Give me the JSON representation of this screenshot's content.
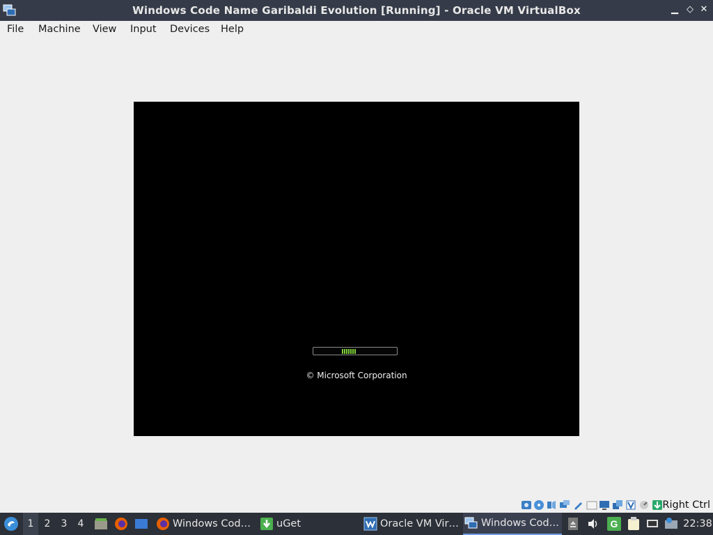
{
  "window": {
    "title": "Windows Code Name Garibaldi Evolution [Running] - Oracle VM VirtualBox",
    "minimize_glyph": "▁",
    "restore_glyph": "◇",
    "close_glyph": "✕"
  },
  "menu": {
    "items": [
      "File",
      "Machine",
      "View",
      "Input",
      "Devices",
      "Help"
    ]
  },
  "vm": {
    "copyright": "© Microsoft Corporation"
  },
  "statusbar": {
    "icons": [
      "hard-disk-icon",
      "optical-drive-icon",
      "audio-icon",
      "network-icon",
      "usb-icon",
      "shared-folders-icon",
      "display-icon",
      "recording-icon",
      "video-capture-icon",
      "cpu-icon",
      "mouse-integration-icon",
      "keyboard-icon"
    ],
    "host_key": "Right Ctrl"
  },
  "taskbar": {
    "workspaces": [
      "1",
      "2",
      "3",
      "4"
    ],
    "active_workspace": "1",
    "launchers": [
      "file-manager-icon",
      "firefox-icon",
      "desktop-icon"
    ],
    "tasks": [
      {
        "label": "Windows Cod…",
        "icon": "firefox-icon"
      },
      {
        "label": "uGet",
        "icon": "uget-icon"
      },
      {
        "label": "Oracle VM Vir…",
        "icon": "virtualbox-manager-icon"
      },
      {
        "label": "Windows Cod…",
        "icon": "virtualbox-vm-icon",
        "active": true
      }
    ],
    "tray_icons": [
      "eject-icon",
      "volume-icon",
      "uget-tray-icon",
      "clipboard-icon",
      "network-tray-icon",
      "updates-icon"
    ],
    "clock": "22:38"
  },
  "colors": {
    "titlebar": "#353b48",
    "taskbar": "#2c3038",
    "progress_green": "#7fcf3a"
  }
}
